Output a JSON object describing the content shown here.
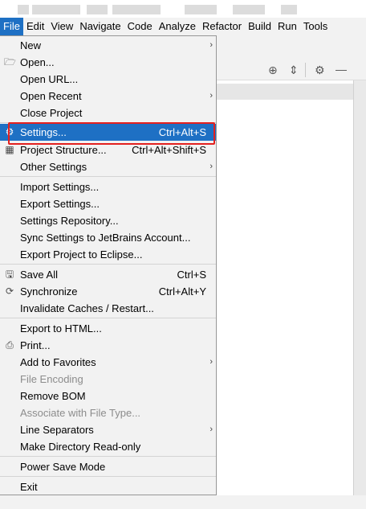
{
  "menubar": {
    "items": [
      "File",
      "Edit",
      "View",
      "Navigate",
      "Code",
      "Analyze",
      "Refactor",
      "Build",
      "Run",
      "Tools"
    ]
  },
  "file_menu": {
    "items": [
      {
        "label": "New",
        "arrow": "›"
      },
      {
        "label": "Open...",
        "icon": "folder-icon"
      },
      {
        "label": "Open URL..."
      },
      {
        "label": "Open Recent",
        "arrow": "›"
      },
      {
        "label": "Close Project"
      },
      {
        "label": "Settings...",
        "shortcut": "Ctrl+Alt+S",
        "icon": "wrench-icon",
        "selected": true
      },
      {
        "label": "Project Structure...",
        "shortcut": "Ctrl+Alt+Shift+S",
        "icon": "project-structure-icon"
      },
      {
        "label": "Other Settings",
        "arrow": "›"
      },
      {
        "label": "Import Settings..."
      },
      {
        "label": "Export Settings..."
      },
      {
        "label": "Settings Repository..."
      },
      {
        "label": "Sync Settings to JetBrains Account..."
      },
      {
        "label": "Export Project to Eclipse..."
      },
      {
        "label": "Save All",
        "shortcut": "Ctrl+S",
        "icon": "save-icon"
      },
      {
        "label": "Synchronize",
        "shortcut": "Ctrl+Alt+Y",
        "icon": "sync-icon"
      },
      {
        "label": "Invalidate Caches / Restart..."
      },
      {
        "label": "Export to HTML..."
      },
      {
        "label": "Print...",
        "icon": "printer-icon"
      },
      {
        "label": "Add to Favorites",
        "arrow": "›"
      },
      {
        "label": "File Encoding",
        "disabled": true
      },
      {
        "label": "Remove BOM"
      },
      {
        "label": "Associate with File Type...",
        "disabled": true
      },
      {
        "label": "Line Separators",
        "arrow": "›"
      },
      {
        "label": "Make Directory Read-only"
      },
      {
        "label": "Power Save Mode"
      },
      {
        "label": "Exit"
      }
    ]
  },
  "icons": {
    "folder": "🗁",
    "save": "🖫",
    "sync": "⟳",
    "printer": "⎙",
    "wrench": "⚙",
    "structure": "▦",
    "target": "⊕",
    "collapse": "⇕",
    "gear": "⚙",
    "minus": "—"
  },
  "colors": {
    "selection": "#1e70c4",
    "highlight_box": "#e3211f",
    "menu_bg": "#f2f2f2"
  }
}
